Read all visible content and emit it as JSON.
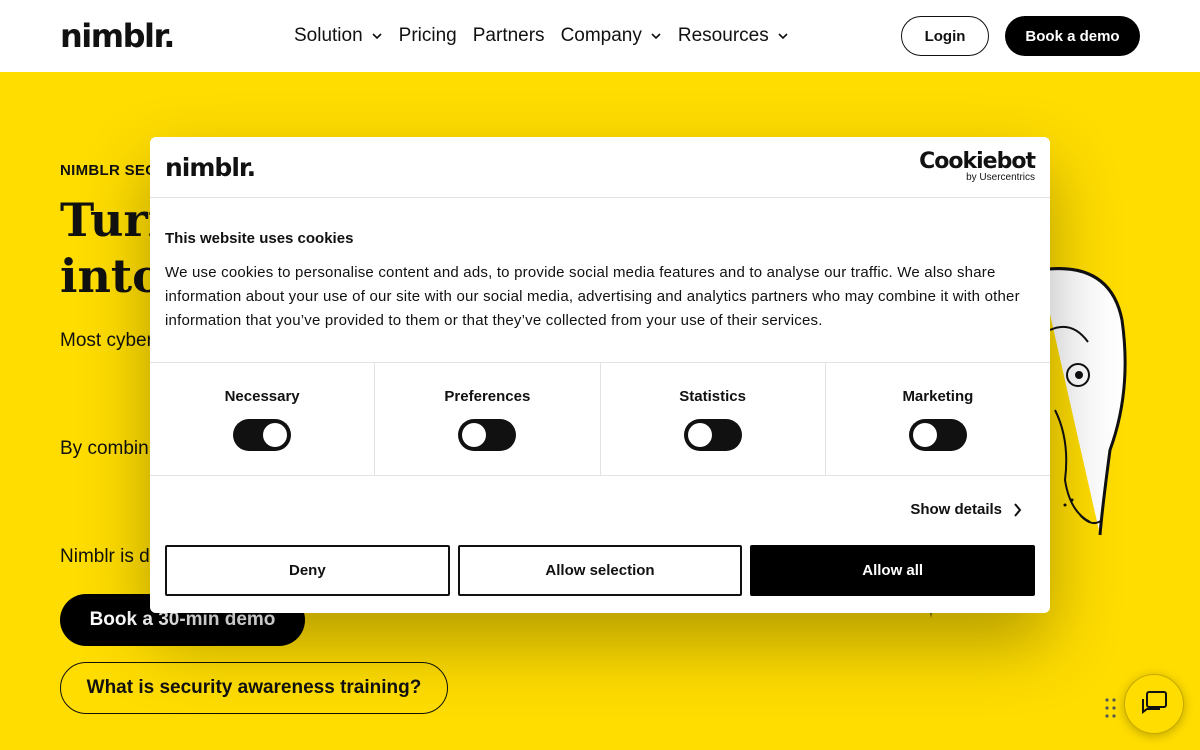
{
  "header": {
    "logo": "nimblr.",
    "nav": [
      {
        "label": "Solution",
        "dropdown": true
      },
      {
        "label": "Pricing",
        "dropdown": false
      },
      {
        "label": "Partners",
        "dropdown": false
      },
      {
        "label": "Company",
        "dropdown": true
      },
      {
        "label": "Resources",
        "dropdown": true
      }
    ],
    "login_label": "Login",
    "demo_label": "Book a demo"
  },
  "hero": {
    "eyebrow": "NIMBLR SECU",
    "title_line1": "Turn",
    "title_line2": "into",
    "p1": "Most cyber organizatio fake.",
    "p2": "By combin influences continuous",
    "p3": "Nimblr is d",
    "demo_button": "Book a 30-min demo",
    "what_button": "What is security awareness training?"
  },
  "cookie_banner": {
    "logo": "nimblr.",
    "provider": "Cookiebot",
    "provider_sub": "by Usercentrics",
    "title": "This website uses cookies",
    "text": "We use cookies to personalise content and ads, to provide social media features and to analyse our traffic. We also share information about your use of our site with our social media, advertising and analytics partners who may combine it with other information that you’ve provided to them or that they’ve collected from your use of their services.",
    "toggles": [
      {
        "label": "Necessary",
        "checked": true
      },
      {
        "label": "Preferences",
        "checked": false
      },
      {
        "label": "Statistics",
        "checked": false
      },
      {
        "label": "Marketing",
        "checked": false
      }
    ],
    "show_details": "Show details",
    "deny": "Deny",
    "allow_selection": "Allow selection",
    "allow_all": "Allow all"
  },
  "colors": {
    "brand_yellow": "#ffdd00",
    "black": "#000000",
    "white": "#ffffff"
  }
}
